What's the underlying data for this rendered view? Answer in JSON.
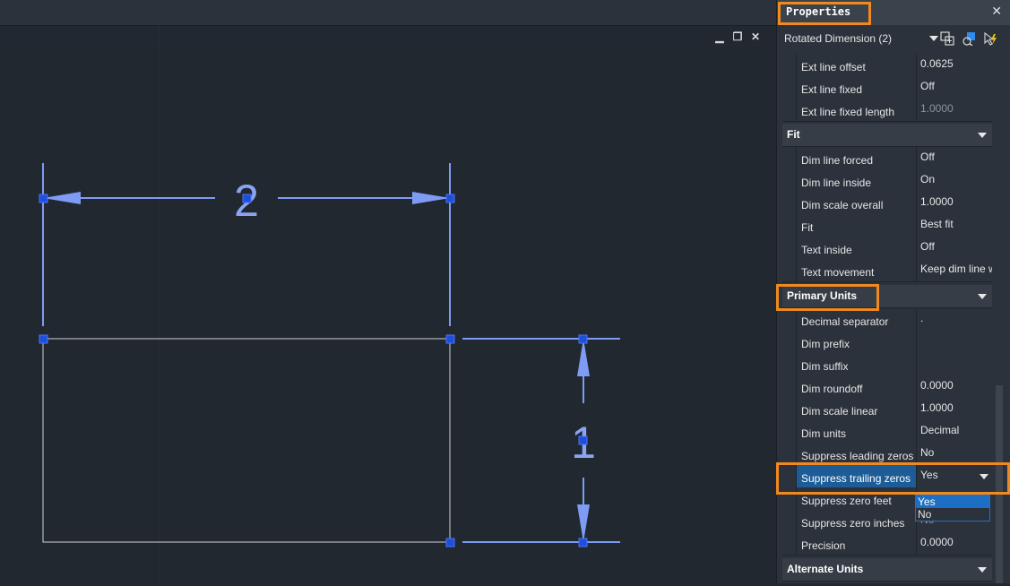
{
  "panel": {
    "title": "Properties",
    "close_glyph": "✕",
    "selection": "Rotated Dimension (2)",
    "toolbar_icons": [
      "toggle-pickadd-icon",
      "select-objects-icon",
      "quick-select-icon"
    ]
  },
  "window_controls": {
    "minimize": "▁",
    "restore": "❐",
    "close": "✕"
  },
  "rows_top": [
    {
      "name": "Ext line offset",
      "value": "0.0625",
      "dim": false
    },
    {
      "name": "Ext line fixed",
      "value": "Off",
      "dim": false
    },
    {
      "name": "Ext line fixed length",
      "value": "1.0000",
      "dim": true
    }
  ],
  "fit_section": {
    "label": "Fit",
    "rows": [
      {
        "name": "Dim line forced",
        "value": "Off"
      },
      {
        "name": "Dim line inside",
        "value": "On"
      },
      {
        "name": "Dim scale overall",
        "value": "1.0000"
      },
      {
        "name": "Fit",
        "value": "Best fit"
      },
      {
        "name": "Text inside",
        "value": "Off"
      },
      {
        "name": "Text movement",
        "value": "Keep dim line w"
      }
    ]
  },
  "primary_units": {
    "label": "Primary Units",
    "rows": [
      {
        "name": "Decimal separator",
        "value": "."
      },
      {
        "name": "Dim prefix",
        "value": ""
      },
      {
        "name": "Dim suffix",
        "value": ""
      },
      {
        "name": "Dim roundoff",
        "value": "0.0000"
      },
      {
        "name": "Dim scale linear",
        "value": "1.0000"
      },
      {
        "name": "Dim units",
        "value": "Decimal"
      },
      {
        "name": "Suppress leading zeros",
        "value": "No"
      },
      {
        "name": "Suppress trailing zeros",
        "value": "Yes"
      },
      {
        "name": "Suppress zero feet",
        "value": ""
      },
      {
        "name": "Suppress zero inches",
        "value": "No"
      },
      {
        "name": "Precision",
        "value": "0.0000"
      }
    ]
  },
  "alternate_units": {
    "label": "Alternate Units"
  },
  "dropdown": {
    "options": [
      "Yes",
      "No"
    ],
    "selected": "Yes"
  },
  "drawing": {
    "dimension_top": "2",
    "dimension_right": "1"
  },
  "colors": {
    "accent": "#f0891e",
    "dimension": "#7f9cf5",
    "grip": "#1f4fd8",
    "selection": "#1d5c96",
    "background": "#212830"
  }
}
